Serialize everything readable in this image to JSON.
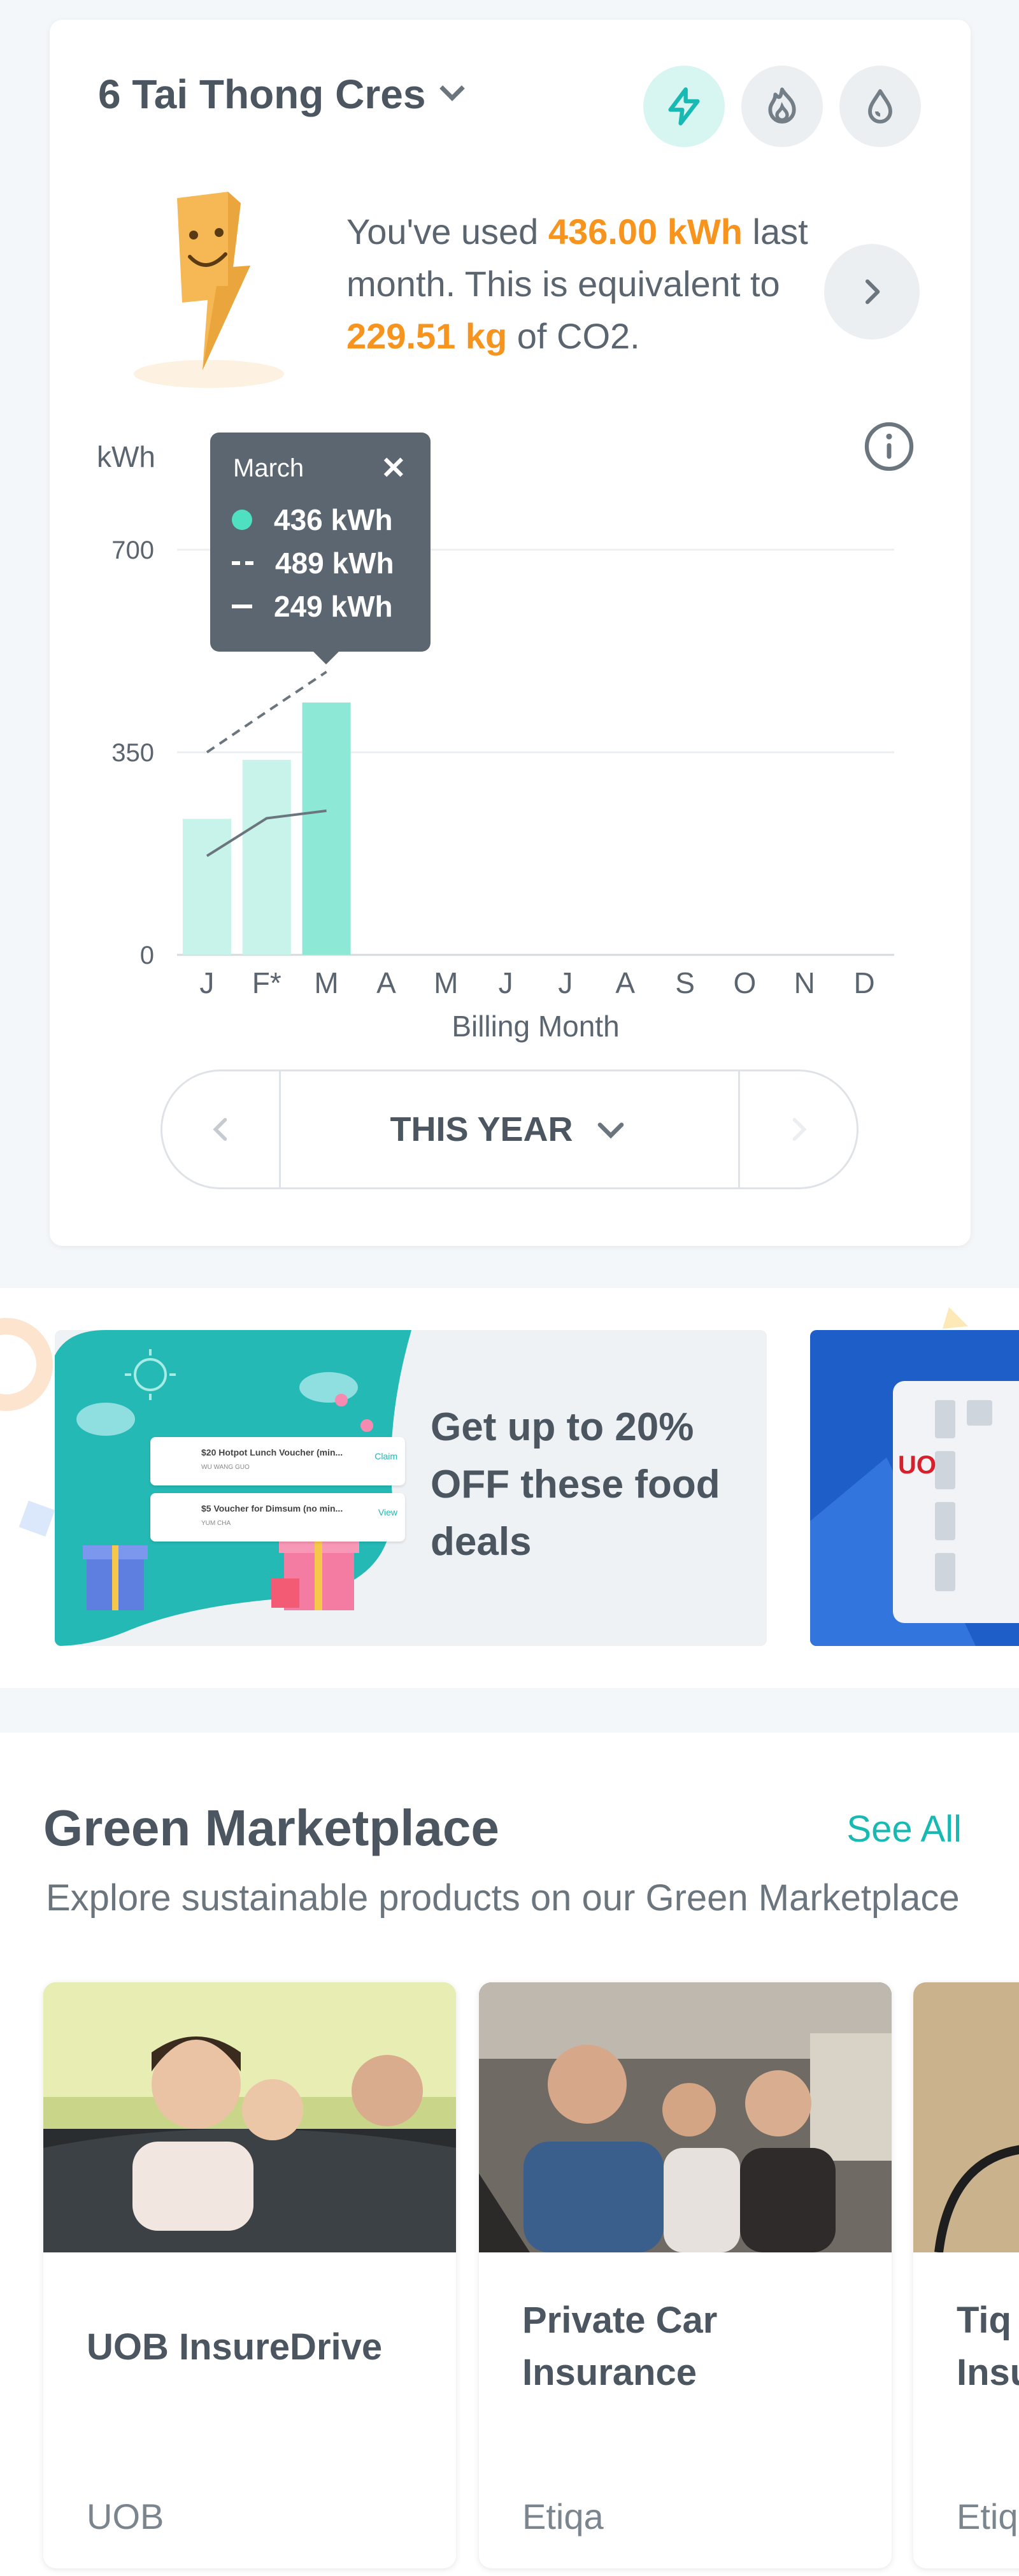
{
  "usage": {
    "address": "6 Tai Thong Cres",
    "utilities": [
      {
        "name": "electricity-icon",
        "active": true
      },
      {
        "name": "gas-icon",
        "active": false
      },
      {
        "name": "water-icon",
        "active": false
      }
    ],
    "summary": {
      "prefix": "You've used ",
      "kwh": "436.00 kWh",
      "middle": " last month. This is equivalent to ",
      "co2": "229.51 kg",
      "suffix": " of CO2."
    },
    "colors": {
      "accent": "#f7941d",
      "bar": "#c7f3ea",
      "bar_active": "#8ee8d6",
      "teal": "#18b9b3"
    }
  },
  "chart_data": {
    "type": "bar",
    "ylabel": "kWh",
    "xlabel": "Billing Month",
    "ylim": [
      0,
      700
    ],
    "yticks": [
      "700",
      "350",
      "0"
    ],
    "categories": [
      "J",
      "F*",
      "M",
      "A",
      "M",
      "J",
      "J",
      "A",
      "S",
      "O",
      "N",
      "D"
    ],
    "series": [
      {
        "values": [
          235,
          337,
          436,
          null,
          null,
          null,
          null,
          null,
          null,
          null,
          null,
          null
        ]
      },
      {
        "style": "dashed",
        "values": [
          350,
          420,
          489,
          null,
          null,
          null,
          null,
          null,
          null,
          null,
          null,
          null
        ]
      },
      {
        "style": "solid",
        "values": [
          171,
          236,
          249,
          null,
          null,
          null,
          null,
          null,
          null,
          null,
          null,
          null
        ]
      }
    ],
    "grid": true,
    "tooltip": {
      "month": "March",
      "close": "✕",
      "rows": [
        "436 kWh",
        "489 kWh",
        "249 kWh"
      ]
    }
  },
  "period": {
    "label": "THIS YEAR"
  },
  "promo": {
    "text": "Get up to 20% OFF these food deals",
    "voucher1": {
      "title": "$20 Hotpot Lunch Voucher (min...",
      "sub": "WU WANG GUO",
      "cta": "Claim"
    },
    "voucher2": {
      "title": "$5 Voucher for Dimsum (no min...",
      "sub": "YUM CHA",
      "cta": "View"
    },
    "card2_brand": "UO"
  },
  "market": {
    "title": "Green Marketplace",
    "see_all": "See All",
    "subtitle": "Explore sustainable products on our Green Marketplace",
    "products": [
      {
        "name": "UOB InsureDrive",
        "brand": "UOB"
      },
      {
        "name": "Private Car Insurance",
        "brand": "Etiqa"
      },
      {
        "name": "Tiq Insu",
        "brand": "Etiq"
      }
    ]
  }
}
